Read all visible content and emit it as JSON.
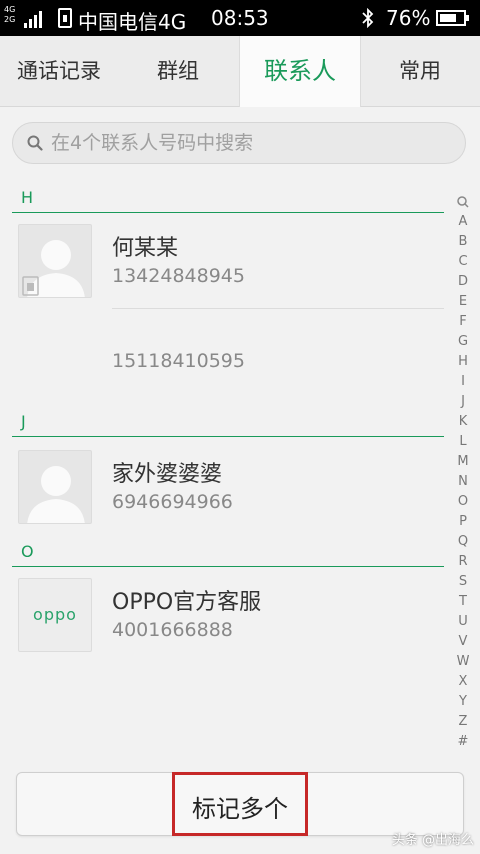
{
  "status_bar": {
    "network_top": "4G",
    "network_bottom": "2G",
    "carrier": "中国电信4G",
    "time": "08:53",
    "battery": "76%",
    "battery_level": 0.76
  },
  "tabs": [
    {
      "label": "通话记录",
      "active": false
    },
    {
      "label": "群组",
      "active": false
    },
    {
      "label": "联系人",
      "active": true
    },
    {
      "label": "常用",
      "active": false
    }
  ],
  "search": {
    "placeholder": "在4个联系人号码中搜索",
    "icon": "search-icon"
  },
  "sections": [
    {
      "letter": "H",
      "contacts": [
        {
          "name": "何某某",
          "phone": "13424848945",
          "avatar": "default-avatar-sim"
        },
        {
          "name": "",
          "phone": "15118410595",
          "avatar": "none"
        }
      ]
    },
    {
      "letter": "J",
      "contacts": [
        {
          "name": "家外婆婆婆",
          "phone": "6946694966",
          "avatar": "default-avatar"
        }
      ]
    },
    {
      "letter": "O",
      "contacts": [
        {
          "name": "OPPO官方客服",
          "phone": "4001666888",
          "avatar": "oppo-logo",
          "avatar_text": "oppo"
        }
      ]
    }
  ],
  "index": [
    "Q",
    "A",
    "B",
    "C",
    "D",
    "E",
    "F",
    "G",
    "H",
    "I",
    "J",
    "K",
    "L",
    "M",
    "N",
    "O",
    "P",
    "Q",
    "R",
    "S",
    "T",
    "U",
    "V",
    "W",
    "X",
    "Y",
    "Z",
    "#"
  ],
  "bottom_button": {
    "label": "标记多个"
  },
  "watermark": "头条 @出海么",
  "colors": {
    "accent": "#1a9a5a",
    "highlight": "#c62828"
  }
}
